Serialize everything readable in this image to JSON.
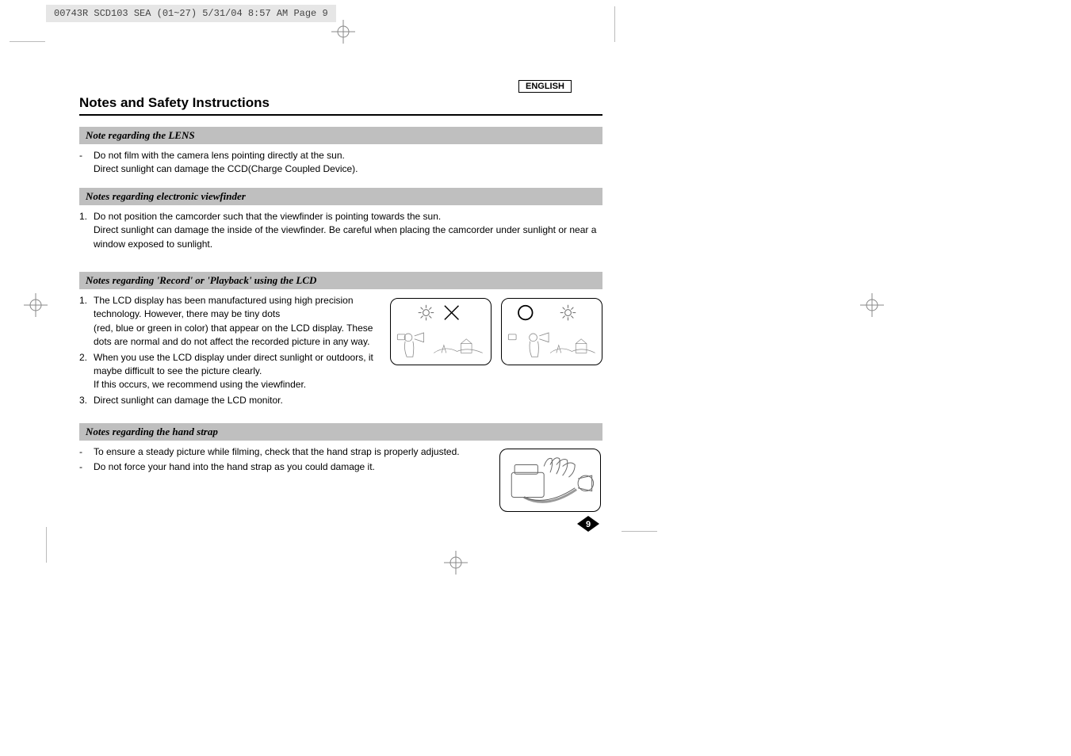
{
  "header_strip": "00743R SCD103 SEA (01~27)  5/31/04 8:57 AM  Page 9",
  "language": "ENGLISH",
  "main_title": "Notes and Safety Instructions",
  "page_number": "9",
  "sections": [
    {
      "heading": "Note regarding the LENS",
      "items": [
        {
          "marker": "-",
          "text": "Do not film with the camera lens pointing directly at the sun.\nDirect sunlight can damage the CCD(Charge Coupled Device)."
        }
      ]
    },
    {
      "heading": "Notes regarding electronic viewfinder",
      "items": [
        {
          "marker": "1.",
          "text": "Do not position the camcorder such that the viewfinder is pointing towards the sun.\nDirect sunlight can damage the inside of the viewfinder. Be careful when placing the camcorder under sunlight or near a window exposed to sunlight."
        }
      ]
    },
    {
      "heading": "Notes regarding 'Record' or 'Playback' using the LCD",
      "items": [
        {
          "marker": "1.",
          "text": "The LCD display has been manufactured using high precision technology. However, there may be tiny dots\n(red, blue or green in color) that appear on the LCD display. These dots are normal and do not affect the recorded picture in any way."
        },
        {
          "marker": "2.",
          "text": "When you use the LCD display under direct sunlight or outdoors, it maybe difficult to see the picture clearly.\nIf this occurs, we recommend using the viewfinder."
        },
        {
          "marker": "3.",
          "text": "Direct sunlight can damage the LCD monitor."
        }
      ]
    },
    {
      "heading": "Notes regarding the hand strap",
      "items": [
        {
          "marker": "-",
          "text": "To ensure a steady picture while filming, check that the hand strap is properly adjusted."
        },
        {
          "marker": "-",
          "text": "Do not force your hand into the hand strap as you could damage it."
        }
      ]
    }
  ]
}
